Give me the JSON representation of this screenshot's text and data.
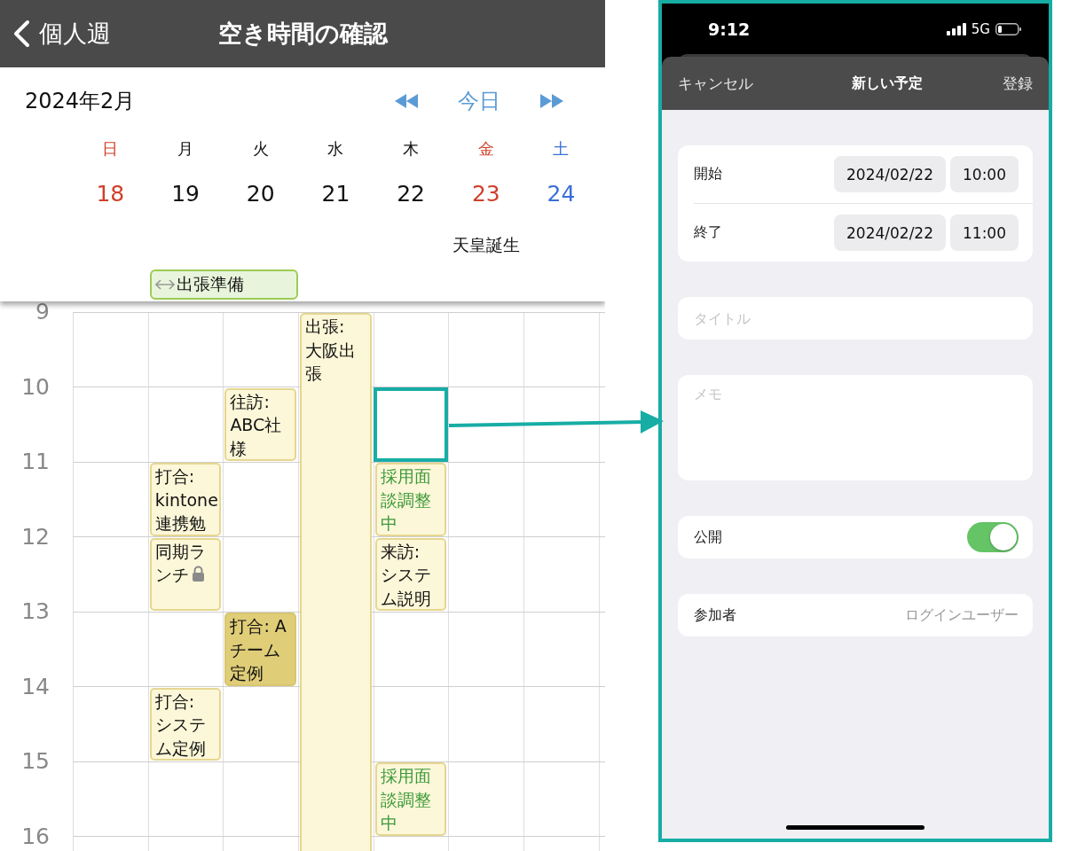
{
  "header": {
    "back_label": "個人週",
    "title": "空き時間の確認"
  },
  "calendar": {
    "month": "2024年2月",
    "today": "今日",
    "days": [
      {
        "weekday": "日",
        "date": "18",
        "color": "#d0402a"
      },
      {
        "weekday": "月",
        "date": "19",
        "color": "#111111",
        "all_day": [
          {
            "title": "出張準備",
            "multi_day": true
          }
        ],
        "slots": [
          {
            "kind": "free"
          },
          {
            "kind": "free"
          },
          {
            "title": "打合: kintone連携勉",
            "kind": "normal"
          },
          {
            "title": "同期ランチ",
            "kind": "normal",
            "private": true
          },
          {
            "kind": "free"
          },
          {
            "title": "打合: システム定例",
            "kind": "normal"
          }
        ]
      },
      {
        "weekday": "火",
        "date": "20",
        "color": "#111111",
        "slots": [
          {
            "kind": "free"
          },
          {
            "title": "往訪: ABC社様",
            "kind": "normal"
          },
          {
            "kind": "free"
          },
          {
            "kind": "free"
          },
          {
            "title": "打合: Aチーム定例",
            "kind": "dark"
          }
        ]
      },
      {
        "weekday": "水",
        "date": "21",
        "color": "#111111",
        "slots": [
          {
            "title": "出張: 大阪出張",
            "kind": "normal",
            "continues": true
          }
        ]
      },
      {
        "weekday": "木",
        "date": "22",
        "color": "#111111",
        "slots": [
          {
            "kind": "free"
          },
          {
            "kind": "selection"
          },
          {
            "title": "採用面談調整中",
            "kind": "tentative"
          },
          {
            "title": "来訪: システム説明",
            "kind": "normal"
          },
          {
            "kind": "free"
          },
          {
            "kind": "free"
          },
          {
            "title": "採用面談調整中",
            "kind": "tentative"
          }
        ]
      },
      {
        "weekday": "金",
        "date": "23",
        "color": "#d0402a",
        "holiday": "天皇誕生"
      },
      {
        "weekday": "土",
        "date": "24",
        "color": "#3a6fd8"
      }
    ],
    "hours": [
      "9",
      "10",
      "11",
      "12",
      "13",
      "14",
      "15",
      "16"
    ]
  },
  "phone": {
    "status_bar": {
      "time": "9:12",
      "network": "5G"
    },
    "modal": {
      "cancel": "キャンセル",
      "title": "新しい予定",
      "save": "登録"
    },
    "schedule": [
      {
        "label": "開始",
        "date": "2024/02/22",
        "time": "10:00"
      },
      {
        "label": "終了",
        "date": "2024/02/22",
        "time": "11:00"
      }
    ],
    "title_field": {
      "placeholder": "タイトル"
    },
    "memo_field": {
      "placeholder": "メモ"
    },
    "public": {
      "label": "公開",
      "on": true
    },
    "attendees": {
      "label": "参加者",
      "value": "ログインユーザー"
    }
  }
}
